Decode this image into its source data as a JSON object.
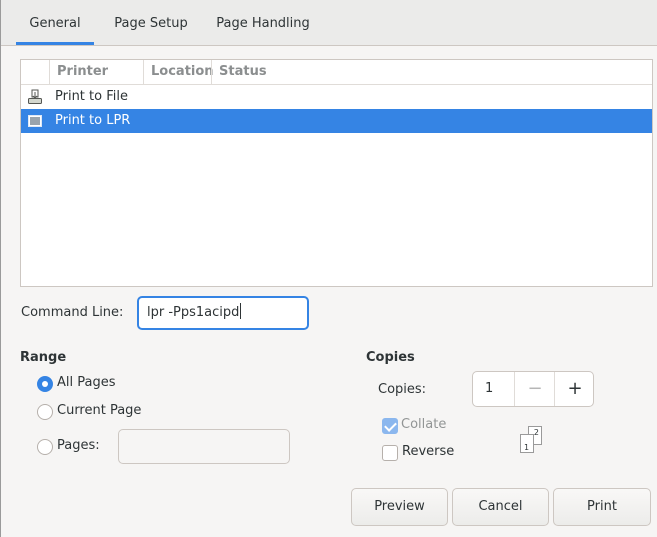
{
  "tabs": [
    {
      "label": "General",
      "active": true
    },
    {
      "label": "Page Setup",
      "active": false
    },
    {
      "label": "Page Handling",
      "active": false
    }
  ],
  "printer_list": {
    "columns": [
      "Printer",
      "Location",
      "Status"
    ],
    "rows": [
      {
        "icon": "file-printer-icon",
        "name": "Print to File",
        "selected": false
      },
      {
        "icon": "lpr-printer-icon",
        "name": "Print to LPR",
        "selected": true
      }
    ]
  },
  "command_line": {
    "label": "Command Line:",
    "value": "lpr -Pps1acipd"
  },
  "range": {
    "title": "Range",
    "options": [
      {
        "label": "All Pages",
        "checked": true
      },
      {
        "label": "Current Page",
        "checked": false
      },
      {
        "label": "Pages:",
        "checked": false
      }
    ],
    "pages_value": ""
  },
  "copies": {
    "title": "Copies",
    "label": "Copies:",
    "value": "1",
    "minus": "−",
    "plus": "+",
    "collate": {
      "label": "Collate",
      "checked": true
    },
    "reverse": {
      "label": "Reverse",
      "checked": false
    },
    "collate_icon": {
      "back_page": "2",
      "front_page": "1"
    }
  },
  "buttons": {
    "preview": "Preview",
    "cancel": "Cancel",
    "print": "Print"
  },
  "colors": {
    "accent": "#3584e4",
    "background": "#f6f5f4"
  }
}
